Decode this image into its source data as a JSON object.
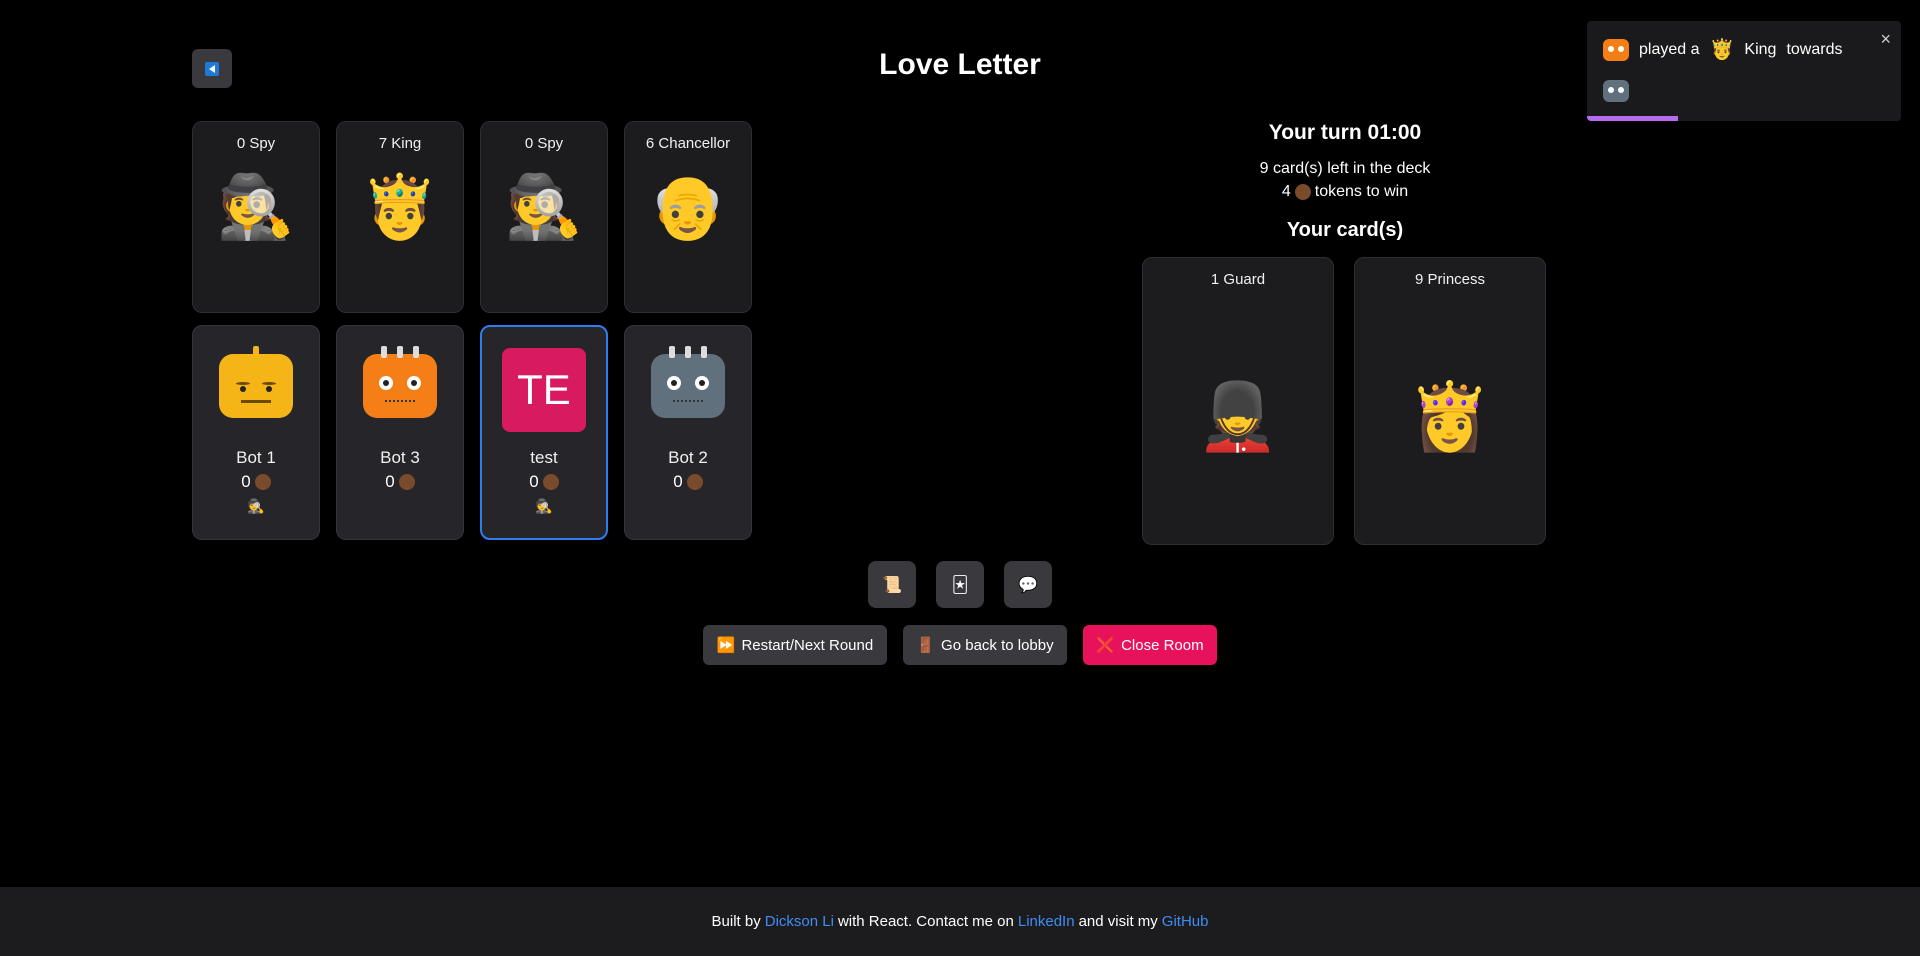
{
  "header": {
    "title": "Love Letter"
  },
  "table_cards": [
    {
      "label": "0 Spy",
      "emoji": "🕵️"
    },
    {
      "label": "7 King",
      "emoji": "🤴"
    },
    {
      "label": "0 Spy",
      "emoji": "🕵️"
    },
    {
      "label": "6 Chancellor",
      "emoji": "👴"
    }
  ],
  "players": [
    {
      "name": "Bot 1",
      "score": "0",
      "mini": "🕵️"
    },
    {
      "name": "Bot 3",
      "score": "0",
      "mini": ""
    },
    {
      "name": "test",
      "initials": "TE",
      "score": "0",
      "mini": "🕵️"
    },
    {
      "name": "Bot 2",
      "score": "0",
      "mini": ""
    }
  ],
  "status": {
    "turn": "Your turn  01:00",
    "deck": "9 card(s) left in the deck",
    "tokens_prefix": "4",
    "tokens_suffix": "tokens to win",
    "your_cards_title": "Your card(s)"
  },
  "hand": [
    {
      "label": "1 Guard",
      "emoji": "💂"
    },
    {
      "label": "9 Princess",
      "emoji": "👸"
    }
  ],
  "tools": [
    {
      "icon": "📜"
    },
    {
      "icon": "🃏"
    },
    {
      "icon": "💬"
    }
  ],
  "actions": {
    "restart_icon": "⏩",
    "restart": "Restart/Next Round",
    "lobby_icon": "🚪",
    "lobby": "Go back to lobby",
    "close_icon": "❌",
    "close": "Close Room"
  },
  "footer": {
    "built_by": "Built by",
    "author": "Dickson Li",
    "mid": "with React. Contact me on",
    "linkedin": "LinkedIn",
    "visit": "and visit my",
    "github": "GitHub"
  },
  "toast": {
    "played": "played a",
    "card_emoji": "🤴",
    "card": "King",
    "towards": "towards",
    "close": "×",
    "progress": 0.29
  },
  "colors": {
    "accent_blue": "#2f7ef0",
    "pink": "#e8115c",
    "link": "#3d8df5",
    "progress": "#b76cf0"
  }
}
